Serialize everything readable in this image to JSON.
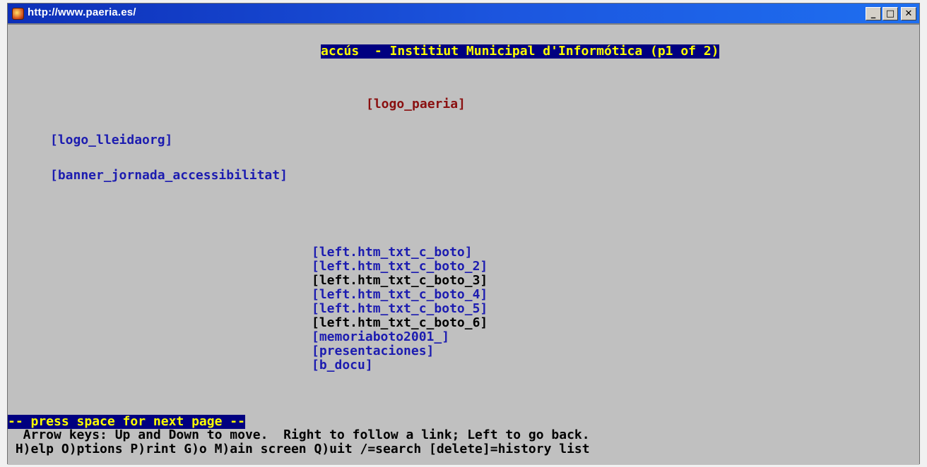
{
  "window": {
    "title": "http://www.paeria.es/",
    "buttons": {
      "minimize": "_",
      "maximize": "□",
      "close": "✕"
    }
  },
  "header": {
    "page_title": "accús  - Institiut Municipal d'Informótica (p1 of 2)"
  },
  "content": {
    "logo_paeria": "[logo_paeria]",
    "logo_lleidaorg": "[logo_lleidaorg]",
    "banner": "[banner_jornada_accessibilitat]",
    "links": [
      {
        "label": "[left.htm_txt_c_boto]",
        "style": "blue"
      },
      {
        "label": "[left.htm_txt_c_boto_2]",
        "style": "blue"
      },
      {
        "label": "[left.htm_txt_c_boto_3]",
        "style": "black"
      },
      {
        "label": "[left.htm_txt_c_boto_4]",
        "style": "blue"
      },
      {
        "label": "[left.htm_txt_c_boto_5]",
        "style": "blue"
      },
      {
        "label": "[left.htm_txt_c_boto_6]",
        "style": "black"
      },
      {
        "label": "[memoriaboto2001_]",
        "style": "blue"
      },
      {
        "label": "[presentaciones]",
        "style": "blue"
      },
      {
        "label": "[b_docu]",
        "style": "blue"
      }
    ]
  },
  "footer": {
    "status": "-- press space for next page --",
    "hint": "  Arrow keys: Up and Down to move.  Right to follow a link; Left to go back.",
    "commands": " H)elp O)ptions P)rint G)o M)ain screen Q)uit /=search [delete]=history list"
  },
  "colors": {
    "titlebar": "#1c56df",
    "terminal_bg": "#c0c0c0",
    "link": "#1c1cb0",
    "highlight_bg": "#000080",
    "highlight_fg": "#ffff00",
    "image_placeholder": "#8a1010"
  }
}
